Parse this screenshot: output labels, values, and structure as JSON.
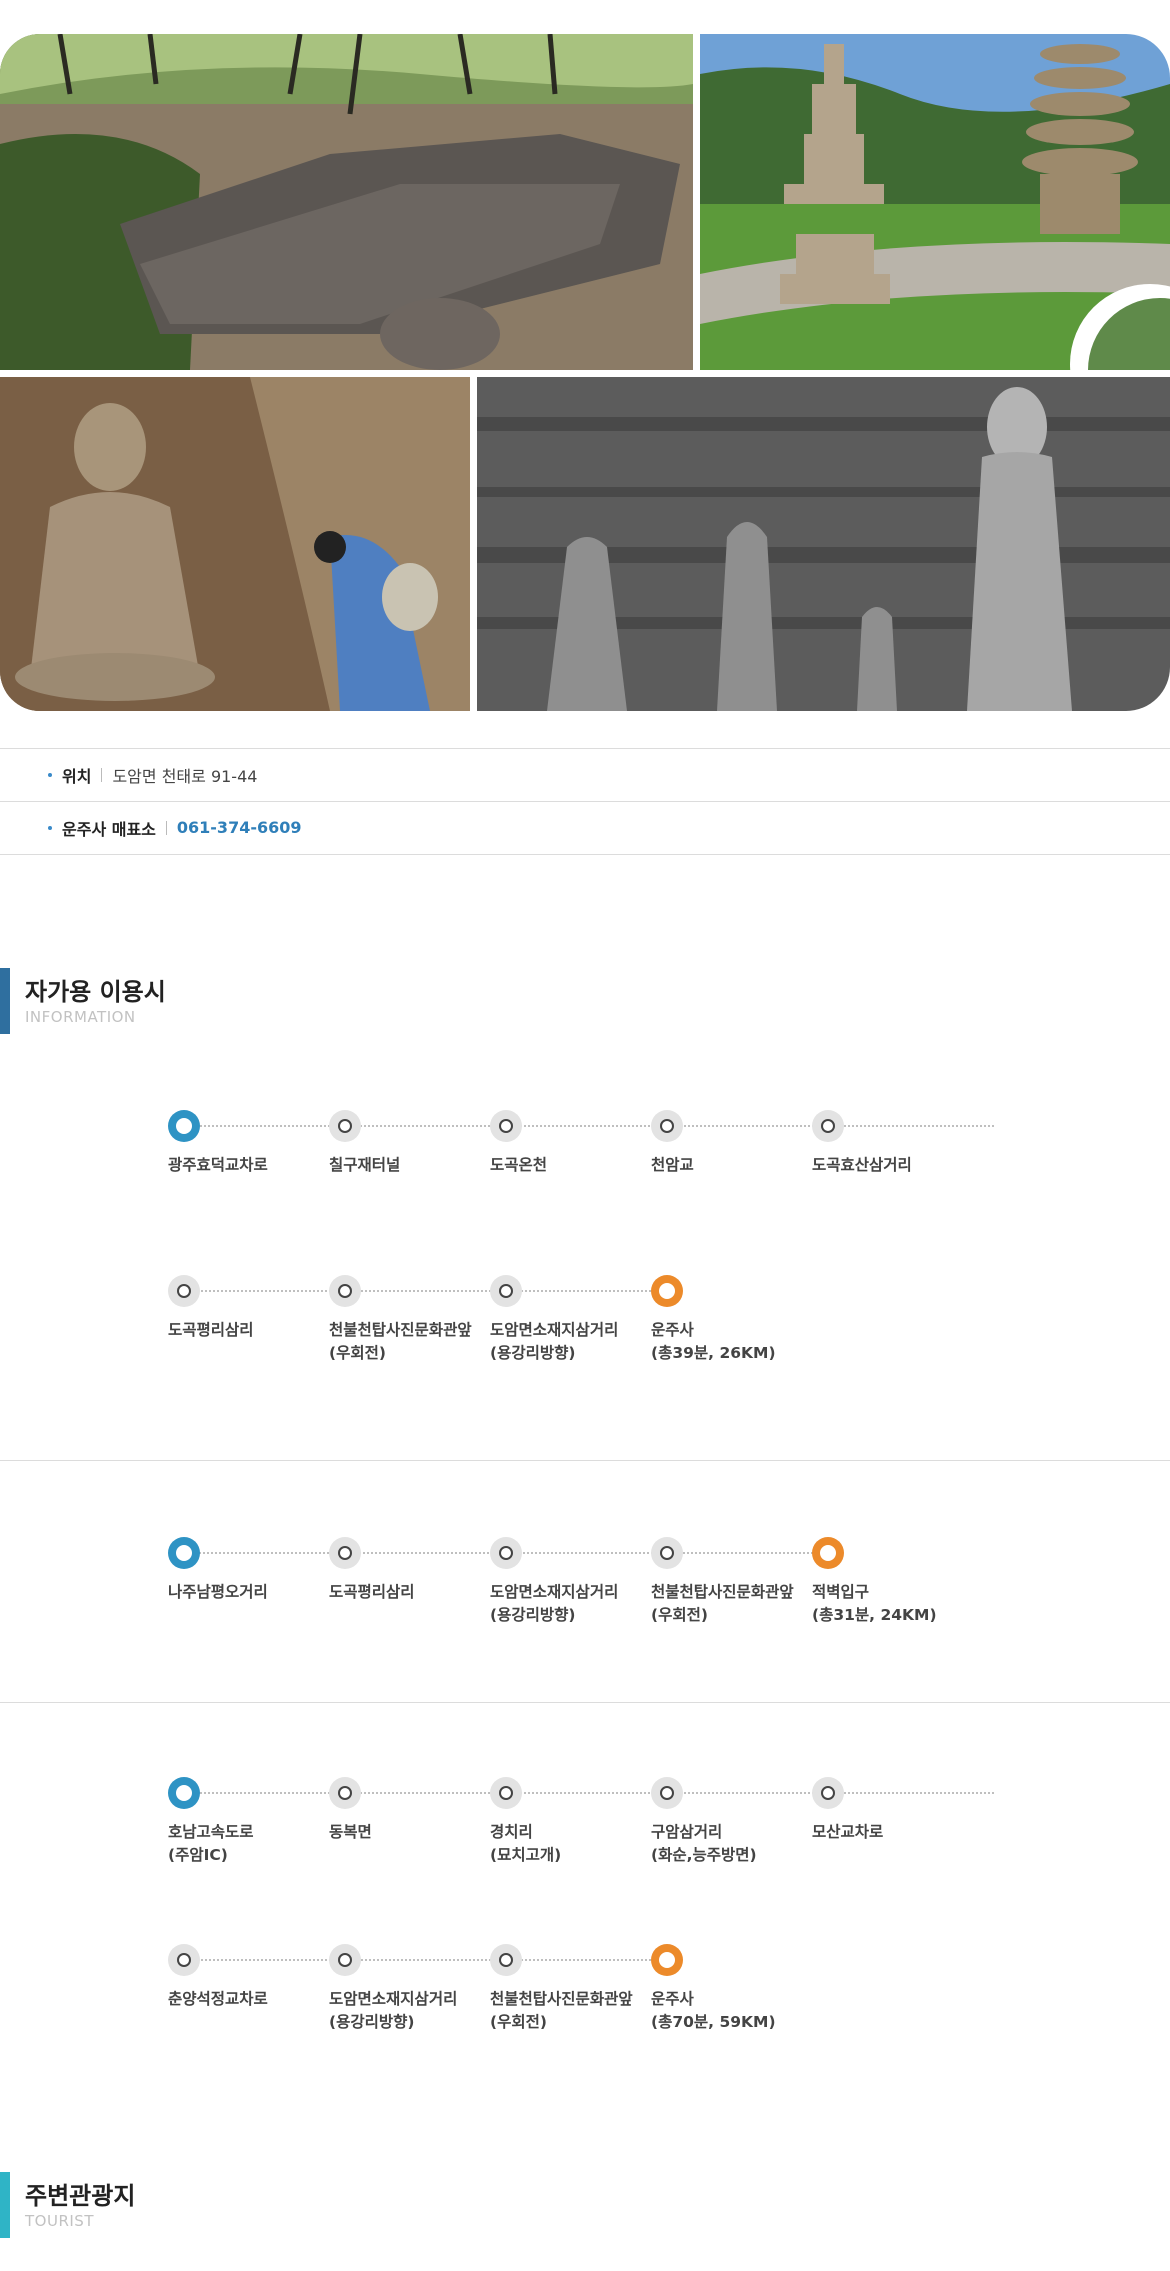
{
  "gallery": {
    "photos": [
      {
        "name": "rock-carving-photo"
      },
      {
        "name": "stone-pagodas-photo"
      },
      {
        "name": "seated-buddha-photo"
      },
      {
        "name": "standing-buddhas-photo"
      }
    ]
  },
  "info": {
    "location_label": "위치",
    "location_value": "도암면 천태로 91-44",
    "ticket_label": "운주사 매표소",
    "ticket_phone": "061-374-6609"
  },
  "sections": {
    "drive_title": "자가용 이용시",
    "drive_sub": "INFORMATION",
    "tourist_title": "주변관광지",
    "tourist_sub": "TOURIST"
  },
  "routes": [
    {
      "stops": [
        {
          "line1": "광주효덕교차로",
          "line2": ""
        },
        {
          "line1": "칠구재터널",
          "line2": ""
        },
        {
          "line1": "도곡온천",
          "line2": ""
        },
        {
          "line1": "천암교",
          "line2": ""
        },
        {
          "line1": "도곡효산삼거리",
          "line2": ""
        }
      ]
    },
    {
      "stops": [
        {
          "line1": "도곡평리삼리",
          "line2": ""
        },
        {
          "line1": "천불천탑사진문화관앞",
          "line2": "(우회전)"
        },
        {
          "line1": "도암면소재지삼거리",
          "line2": "(용강리방향)"
        },
        {
          "line1": "운주사",
          "line2": "(총39분, 26KM)"
        }
      ]
    },
    {
      "stops": [
        {
          "line1": "나주남평오거리",
          "line2": ""
        },
        {
          "line1": "도곡평리삼리",
          "line2": ""
        },
        {
          "line1": "도암면소재지삼거리",
          "line2": "(용강리방향)"
        },
        {
          "line1": "천불천탑사진문화관앞",
          "line2": "(우회전)"
        },
        {
          "line1": "적벽입구",
          "line2": "(총31분, 24KM)"
        }
      ]
    },
    {
      "stops": [
        {
          "line1": "호남고속도로",
          "line2": "(주암IC)"
        },
        {
          "line1": "동복면",
          "line2": ""
        },
        {
          "line1": "경치리",
          "line2": "(묘치고개)"
        },
        {
          "line1": "구암삼거리",
          "line2": "(화순,능주방면)"
        },
        {
          "line1": "모산교차로",
          "line2": ""
        }
      ]
    },
    {
      "stops": [
        {
          "line1": "춘양석정교차로",
          "line2": ""
        },
        {
          "line1": "도암면소재지삼거리",
          "line2": "(용강리방향)"
        },
        {
          "line1": "천불천탑사진문화관앞",
          "line2": "(우회전)"
        },
        {
          "line1": "운주사",
          "line2": "(총70분, 59KM)"
        }
      ]
    }
  ],
  "colors": {
    "start_node": "#2e93c4",
    "end_node": "#ec8a2a",
    "drive_bar": "#2f6f9f",
    "tourist_bar": "#2fb4c6",
    "phone": "#2f7fb9"
  }
}
